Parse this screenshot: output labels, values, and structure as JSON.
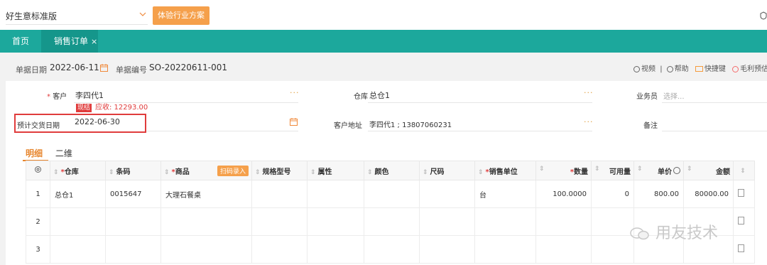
{
  "top": {
    "edition": "好生意标准版",
    "trial_button": "体验行业方案"
  },
  "nav": {
    "home": "首页",
    "active_tab": "销售订单",
    "close_glyph": "×"
  },
  "header": {
    "doc_date_label": "单据日期",
    "doc_date": "2022-06-11",
    "doc_no_label": "单据编号",
    "doc_no": "SO-20220611-001",
    "links": {
      "video": "视频",
      "separator": "|",
      "help": "帮助",
      "shortcut": "快捷键",
      "profit": "毛利预估"
    }
  },
  "form": {
    "customer_label": "客户",
    "customer": "李四代1",
    "customer_ellipsis": "···",
    "receivable_tag": "现结",
    "receivable": "应收: 12293.00",
    "warehouse_label": "仓库",
    "warehouse": "总仓1",
    "warehouse_ellipsis": "···",
    "salesman_label": "业务员",
    "salesman_placeholder": "选择...",
    "delivery_date_label": "预计交货日期",
    "delivery_date": "2022-06-30",
    "address_label": "客户地址",
    "address": "李四代1 ; 13807060231",
    "address_ellipsis": "···",
    "remark_label": "备注"
  },
  "detail_tabs": {
    "detail": "明细",
    "2d": "二维"
  },
  "table": {
    "headers": {
      "warehouse": "仓库",
      "barcode": "条码",
      "product": "商品",
      "scan": "扫码录入",
      "spec": "规格型号",
      "attr": "属性",
      "color": "颜色",
      "size": "尺码",
      "unit": "销售单位",
      "qty": "数量",
      "available": "可用量",
      "price": "单价",
      "amount": "金额"
    },
    "rows": [
      {
        "no": "1",
        "warehouse": "总仓1",
        "barcode": "0015647",
        "product": "大理石餐桌",
        "unit": "台",
        "qty": "100.0000",
        "available": "0",
        "price": "800.00",
        "amount": "80000.00"
      },
      {
        "no": "2"
      },
      {
        "no": "3"
      }
    ]
  },
  "watermark": "用友技术",
  "colors": {
    "nav_bg": "#1ca89c",
    "accent_orange": "#f5a04b",
    "highlight_red": "#e03c3c"
  }
}
